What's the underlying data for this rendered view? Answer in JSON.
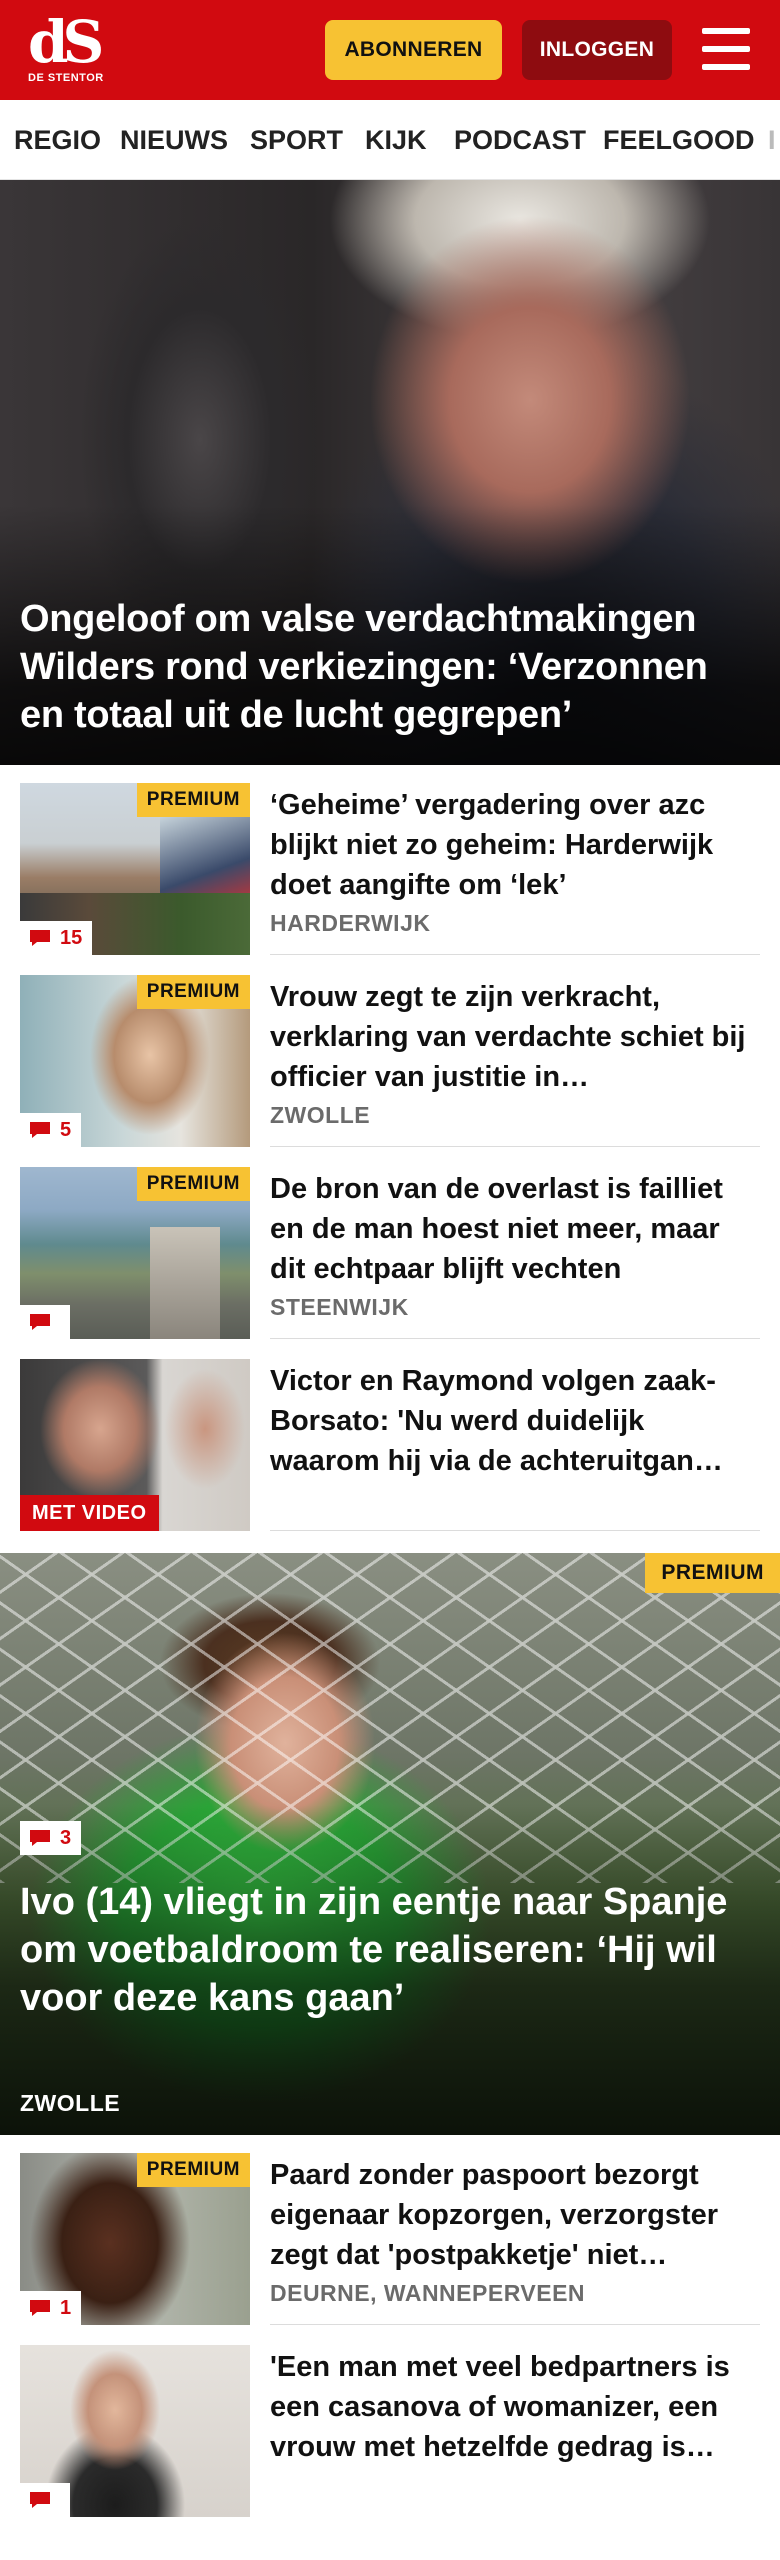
{
  "header": {
    "logo_mark": "dS",
    "logo_sub": "DE STENTOR",
    "subscribe_label": "ABONNEREN",
    "login_label": "INLOGGEN",
    "menu_icon": "hamburger-menu-icon",
    "brand_color": "#d10a10",
    "accent_color": "#f7c233"
  },
  "nav": {
    "items": [
      "REGIO",
      "NIEUWS",
      "SPORT",
      "KIJK",
      "PODCAST",
      "FEELGOOD",
      "I"
    ]
  },
  "hero": {
    "title": "Ongeloof om valse verdachtmakingen Wilders rond verkiezingen: ‘Verzonnen en totaal uit de lucht gegrepen’"
  },
  "articles": [
    {
      "title": "‘Geheime’ vergadering over azc blijkt niet zo geheim: Harderwijk doet aangifte om ‘lek’",
      "label": "HARDERWIJK",
      "premium": "PREMIUM",
      "comments": "15"
    },
    {
      "title": "Vrouw zegt te zijn verkracht, verklaring van verdachte schiet bij officier van justitie in…",
      "label": "ZWOLLE",
      "premium": "PREMIUM",
      "comments": "5"
    },
    {
      "title": "De bron van de overlast is failliet en de man hoest niet meer, maar dit echtpaar blijft vechten",
      "label": "STEENWIJK",
      "premium": "PREMIUM",
      "comments": ""
    },
    {
      "title": "Victor en Raymond volgen zaak-Borsato: 'Nu werd duidelijk waarom hij via de achteruitgan…",
      "video": "MET VIDEO"
    }
  ],
  "hero2": {
    "premium": "PREMIUM",
    "comments": "3",
    "title": "Ivo (14) vliegt in zijn eentje naar Spanje om voetbaldroom te realiseren: ‘Hij wil voor deze kans gaan’",
    "label": "ZWOLLE"
  },
  "articles2": [
    {
      "title": "Paard zonder paspoort bezorgt eigenaar kopzorgen, verzorgster zegt dat 'postpakketje' niet…",
      "label": "DEURNE, WANNEPERVEEN",
      "premium": "PREMIUM",
      "comments": "1"
    },
    {
      "title": "'Een man met veel bedpartners is een casanova of womanizer, een vrouw met hetzelfde gedrag is…",
      "comments": ""
    }
  ]
}
